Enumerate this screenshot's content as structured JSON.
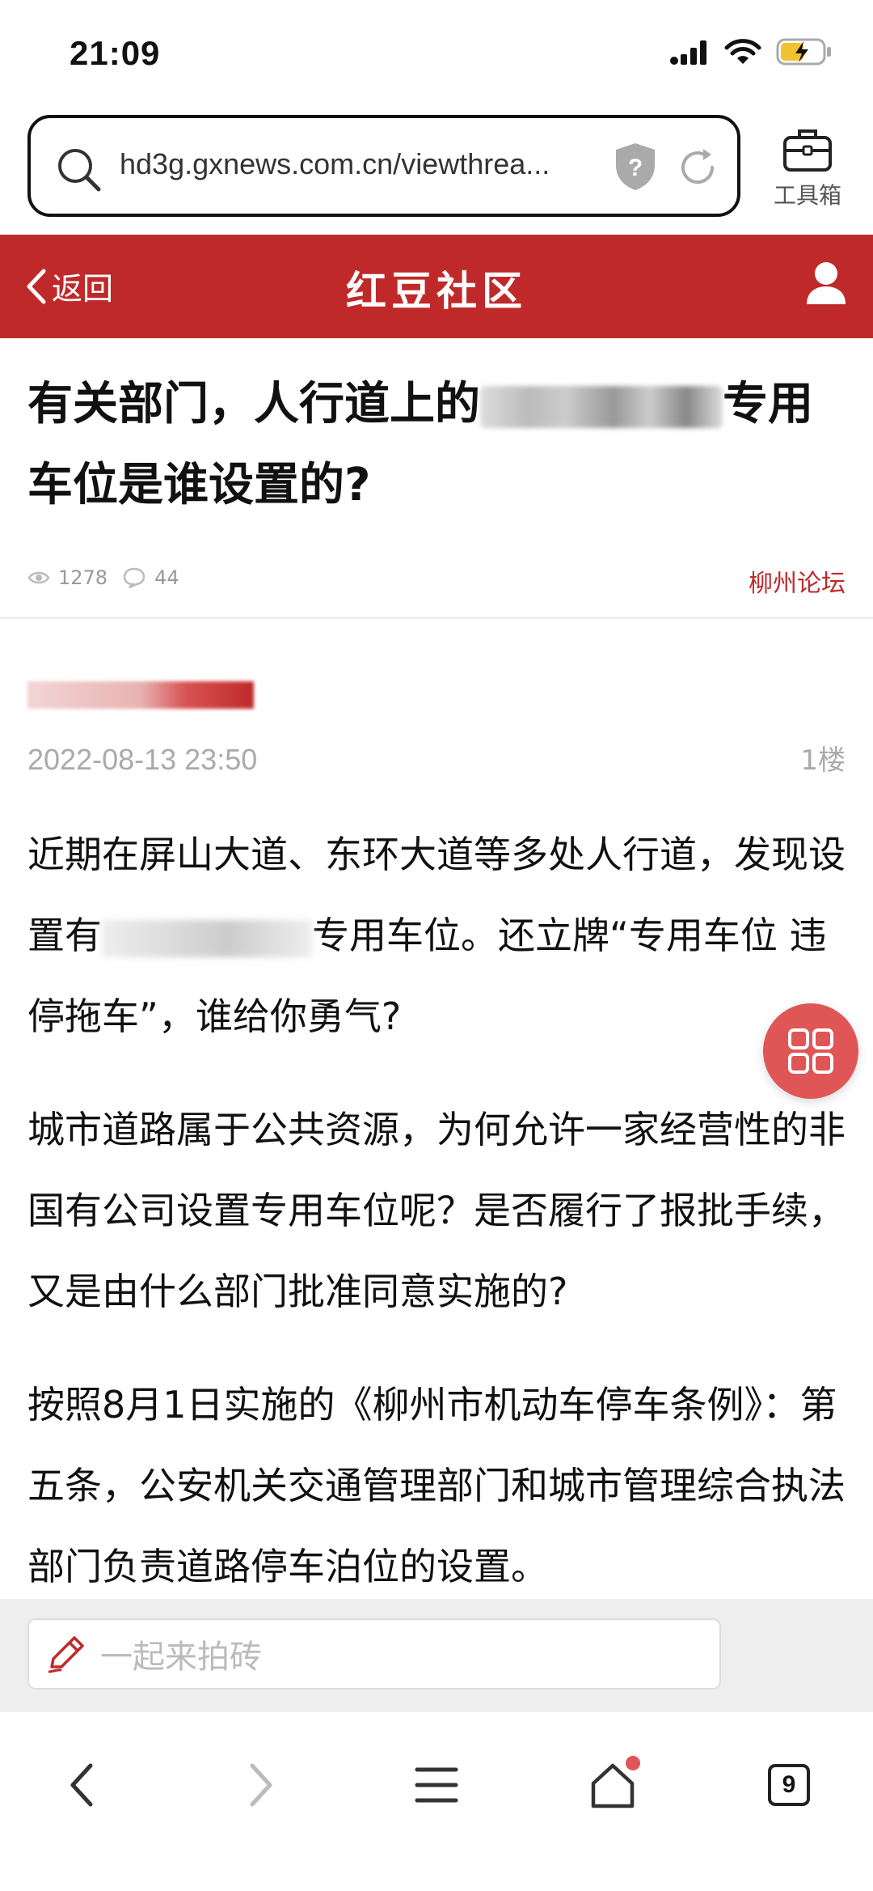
{
  "status": {
    "time": "21:09"
  },
  "browser": {
    "url": "hd3g.gxnews.com.cn/viewthrea...",
    "toolbox_label": "工具箱"
  },
  "header": {
    "back_label": "返回",
    "site_title": "红豆社区"
  },
  "article": {
    "title_part1": "有关部门，人行道上的",
    "title_part2": "专用",
    "title_line2": "车位是谁设置的?",
    "views": "1278",
    "comments": "44",
    "forum": "柳州论坛"
  },
  "post": {
    "date": "2022-08-13 23:50",
    "floor": "1楼",
    "p1_a": "近期在屏山大道、东环大道等多处人行道，发现设置有",
    "p1_b": "专用车位。还立牌“专用车位 违停拖车”，谁给你勇气?",
    "p2": "城市道路属于公共资源，为何允许一家经营性的非国有公司设置专用车位呢？是否履行了报批手续，又是由什么部门批准同意实施的?",
    "p3": "按照8月1日实施的《柳州市机动车停车条例》：第五条，公安机关交通管理部门和城市管理综合执法部门负责道路停车泊位的设置。"
  },
  "comment": {
    "placeholder": "一起来拍砖"
  },
  "nav": {
    "tab_count": "9"
  },
  "colors": {
    "brand_red": "#c0292a",
    "float_red": "#e05656"
  }
}
